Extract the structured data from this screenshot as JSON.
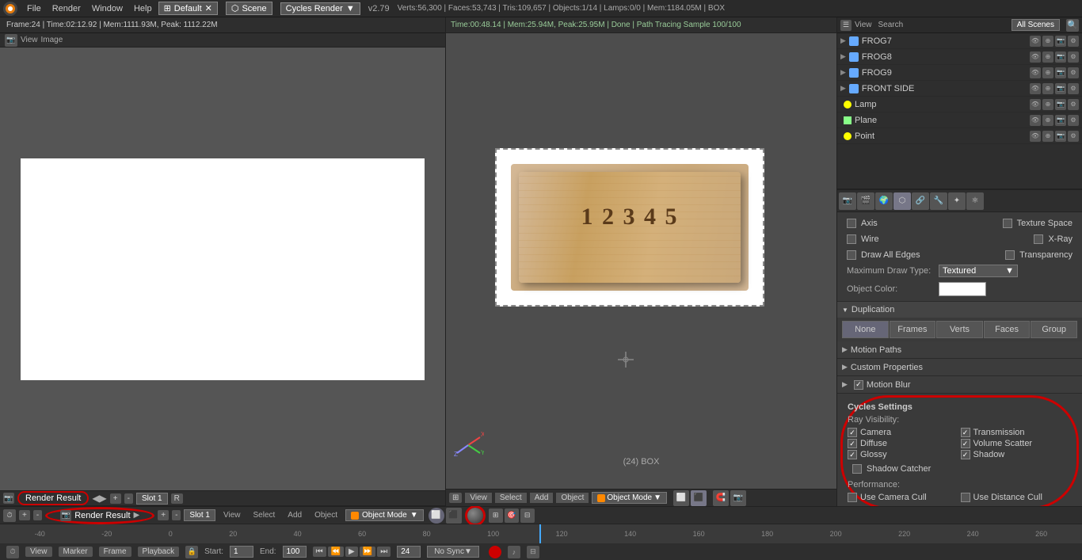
{
  "topbar": {
    "blender_logo": "●",
    "menus": [
      "File",
      "Render",
      "Window",
      "Help"
    ],
    "layout_label": "Default",
    "scene_label": "Scene",
    "cycles_label": "Cycles Render",
    "version": "v2.79",
    "stats": "Verts:56,300 | Faces:53,743 | Tris:109,657 | Objects:1/14 | Lamps:0/0 | Mem:1184.05M | BOX"
  },
  "status_left": {
    "frame": "Frame:24 | Time:02:12.92 | Mem:1111.93M, Peak: 1112.22M"
  },
  "status_right": {
    "info": "Time:00:48.14 | Mem:25.94M, Peak:25.95M | Done | Path Tracing Sample 100/100"
  },
  "outliner": {
    "title": "All Scenes",
    "items": [
      {
        "name": "FROG7",
        "type": "frog"
      },
      {
        "name": "FROG8",
        "type": "frog"
      },
      {
        "name": "FROG9",
        "type": "frog"
      },
      {
        "name": "FRONT SIDE",
        "type": "frog"
      },
      {
        "name": "Lamp",
        "type": "lamp"
      },
      {
        "name": "Plane",
        "type": "plane"
      },
      {
        "name": "Point",
        "type": "lamp"
      }
    ]
  },
  "properties": {
    "sections": {
      "display": {
        "axis_label": "Axis",
        "texture_space_label": "Texture Space",
        "wire_label": "Wire",
        "xray_label": "X-Ray",
        "draw_all_edges_label": "Draw All Edges",
        "transparency_label": "Transparency",
        "max_draw_type_label": "Maximum Draw Type:",
        "object_color_label": "Object Color:",
        "textured_value": "Textured"
      },
      "duplication": {
        "title": "Duplication",
        "buttons": [
          "None",
          "Frames",
          "Verts",
          "Faces",
          "Group"
        ]
      },
      "motion_paths": {
        "title": "Motion Paths"
      },
      "custom_properties": {
        "title": "Custom Properties"
      },
      "motion_blur": {
        "title": "Motion Blur",
        "checkbox": true
      },
      "cycles_settings": {
        "title": "Cycles Settings",
        "ray_visibility_label": "Ray Visibility:",
        "items_left": [
          "Camera",
          "Diffuse",
          "Glossy",
          "Shadow Catcher"
        ],
        "items_right": [
          "Transmission",
          "Volume Scatter",
          "Shadow"
        ],
        "performance_label": "Performance:",
        "perf_items_left": [
          "Use Camera Cull"
        ],
        "perf_items_right": [
          "Use Distance Cull"
        ]
      }
    }
  },
  "viewport": {
    "box_label": "(24) BOX"
  },
  "timeline": {
    "render_result_label": "Render Result",
    "slot_label": "Slot 1",
    "frame_numbers": [
      "-40",
      "-20",
      "0",
      "20",
      "40",
      "60",
      "80",
      "100",
      "120",
      "140",
      "160",
      "180",
      "200",
      "220",
      "240",
      "260"
    ],
    "start_label": "Start:",
    "start_value": "1",
    "end_label": "End:",
    "end_value": "100",
    "frame_value": "24",
    "nosync_label": "No Sync"
  },
  "footer": {
    "menus": [
      "View",
      "Marker",
      "Frame",
      "Playback"
    ]
  }
}
